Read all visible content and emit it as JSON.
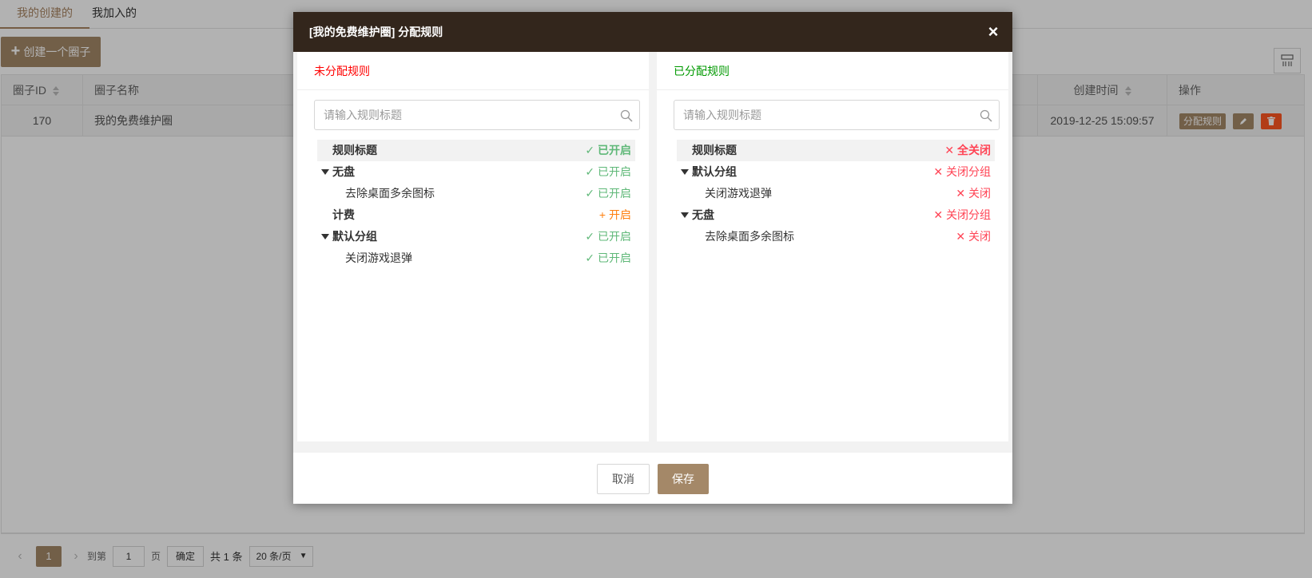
{
  "tabs": [
    {
      "label": "我的创建的"
    },
    {
      "label": "我加入的"
    }
  ],
  "create_button": {
    "label": "创建一个圈子"
  },
  "table": {
    "headers": [
      "圈子ID",
      "圈子名称",
      "创建时间",
      "操作"
    ],
    "rows": [
      {
        "id": "170",
        "name": "我的免费维护圈",
        "created": "2019-12-25 15:09:57"
      }
    ],
    "actions": {
      "assign_label": "分配规则"
    }
  },
  "pager": {
    "current_page": "1",
    "goto_label": "到第",
    "goto_value": "1",
    "page_unit": "页",
    "confirm_label": "确定",
    "total_label": "共 1 条",
    "page_size": "20 条/页"
  },
  "modal": {
    "title": "[我的免费维护圈] 分配规则",
    "close_glyph": "×",
    "left": {
      "title": "未分配规则",
      "search_placeholder": "请输入规则标题",
      "header": {
        "label": "规则标题",
        "status": "✓ 已开启"
      },
      "rows": [
        {
          "label": "无盘",
          "status": "✓ 已开启"
        },
        {
          "label": "去除桌面多余图标",
          "status": "✓ 已开启"
        },
        {
          "label": "计费",
          "status": "+ 开启"
        },
        {
          "label": "默认分组",
          "status": "✓ 已开启"
        },
        {
          "label": "关闭游戏退弹",
          "status": "✓ 已开启"
        }
      ]
    },
    "right": {
      "title": "已分配规则",
      "search_placeholder": "请输入规则标题",
      "header": {
        "label": "规则标题",
        "status": "✕ 全关闭"
      },
      "rows": [
        {
          "label": "默认分组",
          "status": "✕ 关闭分组"
        },
        {
          "label": "关闭游戏退弹",
          "status": "✕ 关闭"
        },
        {
          "label": "无盘",
          "status": "✕ 关闭分组"
        },
        {
          "label": "去除桌面多余图标",
          "status": "✕ 关闭"
        }
      ]
    },
    "cancel_label": "取消",
    "save_label": "保存"
  },
  "colors": {
    "brand": "#a48868",
    "header_bg": "#33261c",
    "enabled_green": "#5fb878",
    "add_orange": "#ff7f0e",
    "close_red": "#ff4455",
    "left_title_red": "#ff0000",
    "right_title_green": "#009900"
  }
}
